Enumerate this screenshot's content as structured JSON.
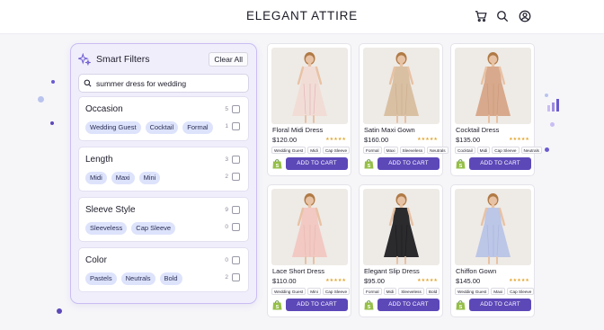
{
  "store": {
    "brand": "ELEGANT ATTIRE"
  },
  "header": {
    "icons": [
      "cart-icon",
      "search-icon",
      "user-icon"
    ]
  },
  "filters": {
    "title": "Smart Filters",
    "clear_label": "Clear All",
    "search_value": "summer dress for wedding",
    "groups": [
      {
        "title": "Occasion",
        "chips": [
          "Wedding Guest",
          "Cocktail",
          "Formal"
        ],
        "counts": [
          "5",
          "1"
        ]
      },
      {
        "title": "Length",
        "chips": [
          "Midi",
          "Maxi",
          "Mini"
        ],
        "counts": [
          "3",
          "2"
        ]
      },
      {
        "title": "Sleeve Style",
        "chips": [
          "Sleeveless",
          "Cap Sleeve"
        ],
        "counts": [
          "9",
          "0"
        ]
      },
      {
        "title": "Color",
        "chips": [
          "Pastels",
          "Neutrals",
          "Bold"
        ],
        "counts": [
          "0",
          "2"
        ]
      }
    ]
  },
  "products": [
    {
      "name": "Floral Midi Dress",
      "price": "$120.00",
      "stars": "★★★★★",
      "tags": [
        "Wedding Guest",
        "Midi",
        "Cap Sleeve"
      ],
      "cta": "ADD TO CART",
      "dress_color": "#f1ddd6",
      "accent": "#d98fa0"
    },
    {
      "name": "Satin Maxi Gown",
      "price": "$160.00",
      "stars": "★★★★★",
      "tags": [
        "Formal",
        "Maxi",
        "Sleeveless",
        "Neutrals"
      ],
      "cta": "ADD TO CART",
      "dress_color": "#d9c0a3",
      "accent": "#bfa07e"
    },
    {
      "name": "Cocktail Dress",
      "price": "$135.00",
      "stars": "★★★★★",
      "tags": [
        "Cocktail",
        "Midi",
        "Cap Sleeve",
        "Neutrals"
      ],
      "cta": "ADD TO CART",
      "dress_color": "#d8a98c",
      "accent": "#c48e70"
    },
    {
      "name": "Lace Short Dress",
      "price": "$110.00",
      "stars": "★★★★★",
      "tags": [
        "Wedding Guest",
        "Mini",
        "Cap Sleeve"
      ],
      "cta": "ADD TO CART",
      "dress_color": "#f2c9c3",
      "accent": "#e0aaa4"
    },
    {
      "name": "Elegant Slip Dress",
      "price": "$95.00",
      "stars": "★★★★★",
      "tags": [
        "Formal",
        "Midi",
        "Sleeveless",
        "Bold"
      ],
      "cta": "ADD TO CART",
      "dress_color": "#2b2b2e",
      "accent": "#111114"
    },
    {
      "name": "Chiffon Gown",
      "price": "$145.00",
      "stars": "★★★★★",
      "tags": [
        "Wedding Guest",
        "Maxi",
        "Cap Sleeve"
      ],
      "cta": "ADD TO CART",
      "dress_color": "#bcc6e6",
      "accent": "#9ea9d6"
    }
  ],
  "colors": {
    "accent": "#5d48b8",
    "panel_border": "#c9bdf3",
    "chip": "#dde3fb",
    "star": "#e3a52a",
    "shopify": "#95bf47"
  }
}
